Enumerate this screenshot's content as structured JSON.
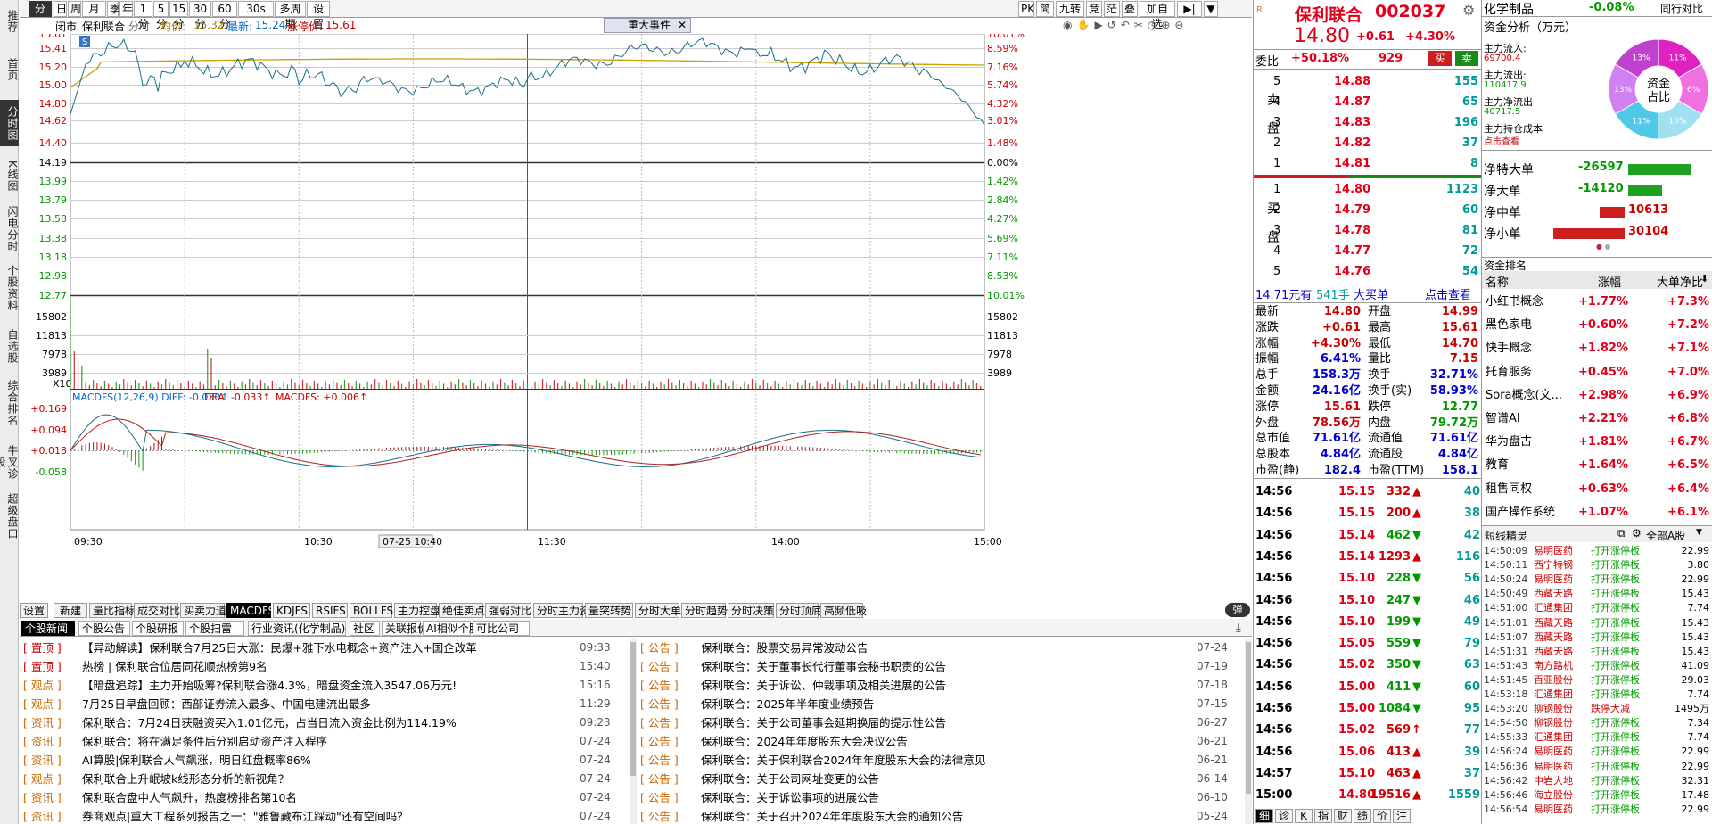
{
  "left_nav": [
    "推荐",
    "首页",
    "分时图",
    "K线图",
    "闪电分时",
    "个股资料",
    "自选股",
    "综合排名",
    "牛叉诊股",
    "超级盘口"
  ],
  "toolbar": {
    "items": [
      "分时",
      "日",
      "周",
      "月",
      "季",
      "年",
      "1分",
      "5分",
      "15分",
      "30分",
      "60分",
      "30s",
      "多周期",
      "设置"
    ],
    "right_items": [
      "PK",
      "简",
      "九转",
      "竞",
      "茫",
      "叠",
      "加自选"
    ]
  },
  "chart_header": {
    "status": "闭市",
    "name": "保利联合",
    "type": "分时",
    "avg_label": "均价:",
    "avg": "15.32",
    "latest_label": "最新:",
    "latest": "15.24",
    "limit_label": "涨停价:",
    "limit": "15.61",
    "event": "重大事件"
  },
  "price_axis": {
    "left": [
      "15.61",
      "15.41",
      "15.20",
      "15.00",
      "14.80",
      "14.62",
      "14.40",
      "14.19",
      "13.99",
      "13.79",
      "13.58",
      "13.38",
      "13.18",
      "12.98",
      "12.77"
    ],
    "right": [
      "10.01%",
      "8.59%",
      "7.16%",
      "5.74%",
      "4.32%",
      "3.01%",
      "1.48%",
      "0.00%",
      "1.42%",
      "2.84%",
      "4.27%",
      "5.69%",
      "7.11%",
      "8.53%",
      "10.01%"
    ]
  },
  "vol_axis": {
    "left": [
      "15802",
      "11813",
      "7978",
      "3989"
    ],
    "right": [
      "15802",
      "11813",
      "7978",
      "3989"
    ],
    "unit": "X10"
  },
  "macd": {
    "label": "MACDFS(12,26,9)",
    "diff": "DIFF: -0.030↑",
    "dea": "DEA: -0.033↑",
    "macdfs": "MACDFS: +0.006↑",
    "axis": [
      "+0.169",
      "+0.094",
      "+0.018",
      "-0.058"
    ]
  },
  "time_axis": [
    "09:30",
    "10:30",
    "07-25 10:40",
    "11:30",
    "14:00",
    "15:00"
  ],
  "signal": "S",
  "bottom_tabs": [
    "设置",
    "新建",
    "量比指标",
    "成交对比",
    "买卖力道",
    "MACDFS",
    "KDJFS",
    "RSIFS",
    "BOLLFS",
    "主力控盘",
    "绝佳卖点",
    "强弱对比",
    "分时主力资金",
    "量突转势",
    "分时大单",
    "分时趋势",
    "分时决策",
    "分时顶底",
    "高频低吸"
  ],
  "toggle_label": "弹",
  "news_tabs": [
    "个股新闻",
    "个股公告",
    "个股研报",
    "个股扫雷",
    "行业资讯(化学制品)",
    "社区",
    "关联报价",
    "AI相似个股",
    "可比公司"
  ],
  "news_left": [
    {
      "tag": "置顶",
      "title": "【异动解读】保利联合7月25日大涨：民爆+雅下水电概念+资产注入+国企改革",
      "date": "09:33",
      "tagc": "#cc0000"
    },
    {
      "tag": "置顶",
      "title": "热榜 | 保利联合位居同花顺热榜第9名",
      "date": "15:40",
      "tagc": "#cc0000"
    },
    {
      "tag": "观点",
      "title": "【暗盘追踪】主力开始吸筹?保利联合涨4.3%，暗盘资金流入3547.06万元!",
      "date": "15:16",
      "tagc": "#cc6600"
    },
    {
      "tag": "观点",
      "title": "7月25日早盘回顾：西部证券流入最多、中国电建流出最多",
      "date": "11:29",
      "tagc": "#cc6600"
    },
    {
      "tag": "资讯",
      "title": "保利联合：7月24日获融资买入1.01亿元，占当日流入资金比例为114.19%",
      "date": "09:23",
      "tagc": "#cc6600"
    },
    {
      "tag": "资讯",
      "title": "保利联合：将在满足条件后分别启动资产注入程序",
      "date": "07-24",
      "tagc": "#cc6600"
    },
    {
      "tag": "资讯",
      "title": "AI算股|保利联合人气飙涨，明日红盘概率86%",
      "date": "07-24",
      "tagc": "#cc6600"
    },
    {
      "tag": "观点",
      "title": "保利联合上升岷坡k线形态分析的新视角？",
      "date": "07-24",
      "tagc": "#cc6600"
    },
    {
      "tag": "资讯",
      "title": "保利联合盘中人气飙升，热度榜排名第10名",
      "date": "07-24",
      "tagc": "#cc6600"
    },
    {
      "tag": "资讯",
      "title": "券商观点|重大工程系列报告之一：\"雅鲁藏布江踩动\"还有空间吗？",
      "date": "07-24",
      "tagc": "#cc6600"
    }
  ],
  "news_right": [
    {
      "tag": "公告",
      "title": "保利联合：股票交易异常波动公告",
      "date": "07-24"
    },
    {
      "tag": "公告",
      "title": "保利联合：关于董事长代行董事会秘书职责的公告",
      "date": "07-19"
    },
    {
      "tag": "公告",
      "title": "保利联合：关于诉讼、仲裁事项及相关进展的公告",
      "date": "07-18"
    },
    {
      "tag": "公告",
      "title": "保利联合：2025年半年度业绩预告",
      "date": "07-15"
    },
    {
      "tag": "公告",
      "title": "保利联合：关于公司董事会延期换届的提示性公告",
      "date": "06-27"
    },
    {
      "tag": "公告",
      "title": "保利联合：2024年年度股东大会决议公告",
      "date": "06-21"
    },
    {
      "tag": "公告",
      "title": "保利联合：关于保利联合2024年年度股东大会的法律意见",
      "date": "06-21"
    },
    {
      "tag": "公告",
      "title": "保利联合：关于公司网址变更的公告",
      "date": "06-14"
    },
    {
      "tag": "公告",
      "title": "保利联合：关于诉讼事项的进展公告",
      "date": "06-10"
    },
    {
      "tag": "公告",
      "title": "保利联合：关于召开2024年年度股东大会的通知公告",
      "date": "05-24"
    }
  ],
  "quote": {
    "flag": "R",
    "name": "保利联合",
    "code": "002037",
    "price": "14.80",
    "change": "+0.61",
    "pct": "+4.30%",
    "wb_label": "委比",
    "wb": "+50.18%",
    "wb_vol": "929",
    "buy": "买",
    "sell": "卖",
    "sell_label": "卖盘",
    "buy_label": "买盘",
    "asks": [
      {
        "lv": "5",
        "p": "14.88",
        "v": "155"
      },
      {
        "lv": "4",
        "p": "14.87",
        "v": "65"
      },
      {
        "lv": "3",
        "p": "14.83",
        "v": "196"
      },
      {
        "lv": "2",
        "p": "14.82",
        "v": "37"
      },
      {
        "lv": "1",
        "p": "14.81",
        "v": "8"
      }
    ],
    "bids": [
      {
        "lv": "1",
        "p": "14.80",
        "v": "1123"
      },
      {
        "lv": "2",
        "p": "14.79",
        "v": "60"
      },
      {
        "lv": "3",
        "p": "14.78",
        "v": "81"
      },
      {
        "lv": "4",
        "p": "14.77",
        "v": "72"
      },
      {
        "lv": "5",
        "p": "14.76",
        "v": "54"
      }
    ],
    "bigbuy": {
      "amt": "14.71元有",
      "vol": "541手",
      "label": "大买单",
      "link": "点击查看"
    },
    "stats": [
      [
        "最新",
        "14.80",
        "开盘",
        "14.99"
      ],
      [
        "涨跌",
        "+0.61",
        "最高",
        "15.61"
      ],
      [
        "涨幅",
        "+4.30%",
        "最低",
        "14.70"
      ],
      [
        "振幅",
        "6.41%",
        "量比",
        "7.15"
      ],
      [
        "总手",
        "158.3万",
        "换手",
        "32.71%"
      ],
      [
        "金额",
        "24.16亿",
        "换手(实)",
        "58.93%"
      ],
      [
        "涨停",
        "15.61",
        "跌停",
        "12.77"
      ],
      [
        "外盘",
        "78.56万",
        "内盘",
        "79.72万"
      ],
      [
        "总市值",
        "71.61亿",
        "流通值",
        "71.61亿"
      ],
      [
        "总股本",
        "4.84亿",
        "流通股",
        "4.84亿"
      ],
      [
        "市盈(静)",
        "182.4",
        "市盈(TTM)",
        "158.1"
      ]
    ],
    "ticks": [
      {
        "t": "14:56",
        "p": "15.15",
        "v": "332",
        "d": "▲",
        "n": "40"
      },
      {
        "t": "14:56",
        "p": "15.15",
        "v": "200",
        "d": "▲",
        "n": "38"
      },
      {
        "t": "14:56",
        "p": "15.14",
        "v": "462",
        "d": "▼",
        "n": "42"
      },
      {
        "t": "14:56",
        "p": "15.14",
        "v": "1293",
        "d": "▲",
        "n": "116"
      },
      {
        "t": "14:56",
        "p": "15.10",
        "v": "228",
        "d": "▼",
        "n": "56"
      },
      {
        "t": "14:56",
        "p": "15.10",
        "v": "247",
        "d": "▼",
        "n": "46"
      },
      {
        "t": "14:56",
        "p": "15.10",
        "v": "199",
        "d": "▼",
        "n": "49"
      },
      {
        "t": "14:56",
        "p": "15.05",
        "v": "559",
        "d": "▼",
        "n": "79"
      },
      {
        "t": "14:56",
        "p": "15.02",
        "v": "350",
        "d": "▼",
        "n": "63"
      },
      {
        "t": "14:56",
        "p": "15.00",
        "v": "411",
        "d": "▼",
        "n": "60"
      },
      {
        "t": "14:56",
        "p": "15.00",
        "v": "1084",
        "d": "▼",
        "n": "95"
      },
      {
        "t": "14:56",
        "p": "15.02",
        "v": "569",
        "d": "↑",
        "n": "77"
      },
      {
        "t": "14:56",
        "p": "15.06",
        "v": "413",
        "d": "▲",
        "n": "39"
      },
      {
        "t": "14:57",
        "p": "15.10",
        "v": "463",
        "d": "▲",
        "n": "37"
      },
      {
        "t": "15:00",
        "p": "14.80",
        "v": "19516",
        "d": "▲",
        "n": "1559"
      }
    ],
    "bottom_tabs": [
      "细",
      "诊",
      "K",
      "指",
      "财",
      "绩",
      "价",
      "注"
    ]
  },
  "fr": {
    "sector": "化学制品",
    "sector_pct": "-0.08%",
    "compare": "同行对比",
    "fund_title": "资金分析（万元）",
    "fund": [
      {
        "k": "主力流入:",
        "v": "69700.4"
      },
      {
        "k": "主力流出:",
        "v": "110417.9"
      },
      {
        "k": "主力净流出",
        "v": "40717.5"
      },
      {
        "k": "主力持仓成本",
        "v": "点击查看"
      }
    ],
    "donut": [
      "资金",
      "占比"
    ],
    "donut_pcts": [
      "11%",
      "6%",
      "10%",
      "11%",
      "13%",
      "13%"
    ],
    "net": [
      {
        "k": "净特大单",
        "v": "-26597",
        "w": 0.71,
        "c": "#20a020"
      },
      {
        "k": "净大单",
        "v": "-14120",
        "w": 0.38,
        "c": "#20a020"
      },
      {
        "k": "净中单",
        "v": "10613",
        "w": 0.28,
        "c": "#cc2020"
      },
      {
        "k": "净小单",
        "v": "30104",
        "w": 0.8,
        "c": "#cc2020"
      }
    ],
    "rank_title": "资金排名",
    "rank_head": [
      "名称",
      "涨幅",
      "大单净比"
    ],
    "rank": [
      [
        "小红书概念",
        "+1.77%",
        "+7.3%"
      ],
      [
        "黑色家电",
        "+0.60%",
        "+7.2%"
      ],
      [
        "快手概念",
        "+1.82%",
        "+7.1%"
      ],
      [
        "托育服务",
        "+0.45%",
        "+7.0%"
      ],
      [
        "Sora概念(文...",
        "+2.98%",
        "+6.9%"
      ],
      [
        "智谱AI",
        "+2.21%",
        "+6.8%"
      ],
      [
        "华为盘古",
        "+1.81%",
        "+6.7%"
      ],
      [
        "教育",
        "+1.64%",
        "+6.5%"
      ],
      [
        "租售同权",
        "+0.63%",
        "+6.4%"
      ],
      [
        "国产操作系统",
        "+1.07%",
        "+6.1%"
      ]
    ],
    "dx_title": "短线精灵",
    "dx_filter": "全部A股",
    "dx": [
      [
        "14:50:09",
        "易明医药",
        "打开涨停板",
        "22.99"
      ],
      [
        "14:50:11",
        "西宁特钢",
        "打开涨停板",
        "3.80"
      ],
      [
        "14:50:24",
        "易明医药",
        "打开涨停板",
        "22.99"
      ],
      [
        "14:50:49",
        "西藏天路",
        "打开涨停板",
        "15.43"
      ],
      [
        "14:51:00",
        "汇通集团",
        "打开涨停板",
        "7.74"
      ],
      [
        "14:51:01",
        "西藏天路",
        "打开涨停板",
        "15.43"
      ],
      [
        "14:51:07",
        "西藏天路",
        "打开涨停板",
        "15.43"
      ],
      [
        "14:51:31",
        "西藏天路",
        "打开涨停板",
        "15.43"
      ],
      [
        "14:51:43",
        "南方路机",
        "打开涨停板",
        "41.09"
      ],
      [
        "14:51:45",
        "百亚股份",
        "打开涨停板",
        "29.03"
      ],
      [
        "14:53:18",
        "汇通集团",
        "打开涨停板",
        "7.74"
      ],
      [
        "14:53:20",
        "柳钢股份",
        "跌停大减",
        "1495万"
      ],
      [
        "14:54:50",
        "柳钢股份",
        "打开涨停板",
        "7.34"
      ],
      [
        "14:55:33",
        "汇通集团",
        "打开涨停板",
        "7.74"
      ],
      [
        "14:56:24",
        "易明医药",
        "打开涨停板",
        "22.99"
      ],
      [
        "14:56:36",
        "易明医药",
        "打开涨停板",
        "22.99"
      ],
      [
        "14:56:42",
        "中岩大地",
        "打开涨停板",
        "32.31"
      ],
      [
        "14:56:46",
        "海立股份",
        "打开涨停板",
        "17.48"
      ],
      [
        "14:56:54",
        "易明医药",
        "打开涨停板",
        "22.99"
      ]
    ]
  }
}
